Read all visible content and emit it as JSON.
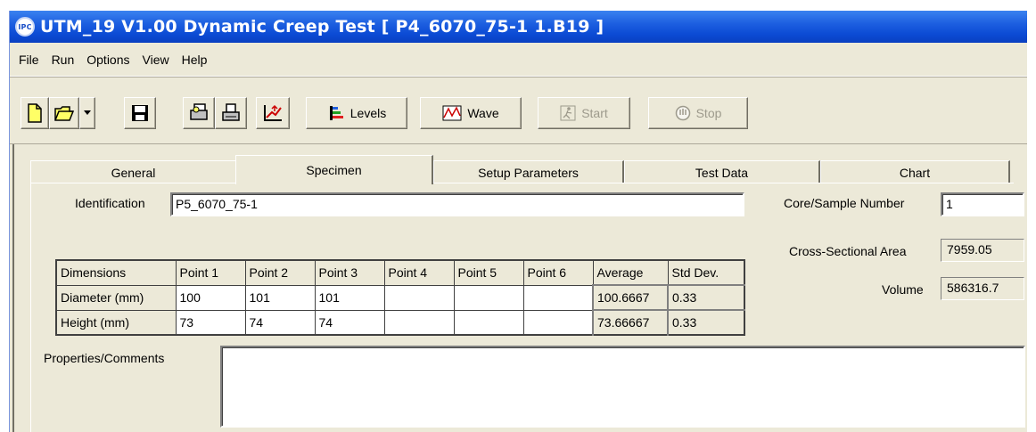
{
  "window": {
    "title": "UTM_19  V1.00 Dynamic Creep Test [ P4_6070_75-1 1.B19 ]",
    "icon": "IPC"
  },
  "menu": [
    "File",
    "Run",
    "Options",
    "View",
    "Help"
  ],
  "toolbar": {
    "levels_label": "Levels",
    "wave_label": "Wave",
    "start_label": "Start",
    "stop_label": "Stop"
  },
  "tabs": [
    "General",
    "Specimen",
    "Setup Parameters",
    "Test Data",
    "Chart"
  ],
  "active_tab": "Specimen",
  "specimen": {
    "identification_label": "Identification",
    "identification_value": "P5_6070_75-1",
    "core_label": "Core/Sample Number",
    "core_value": "1",
    "area_label": "Cross-Sectional Area",
    "area_value": "7959.05",
    "volume_label": "Volume",
    "volume_value": "586316.7",
    "comments_label": "Properties/Comments",
    "comments_value": "",
    "table": {
      "headers": [
        "Dimensions",
        "Point 1",
        "Point 2",
        "Point 3",
        "Point 4",
        "Point 5",
        "Point 6",
        "Average",
        "Std Dev."
      ],
      "rows": [
        {
          "label": "Diameter (mm)",
          "points": [
            "100",
            "101",
            "101",
            "",
            "",
            ""
          ],
          "average": "100.6667",
          "std": "0.33"
        },
        {
          "label": "Height (mm)",
          "points": [
            "73",
            "74",
            "74",
            "",
            "",
            ""
          ],
          "average": "73.66667",
          "std": "0.33"
        }
      ]
    }
  }
}
